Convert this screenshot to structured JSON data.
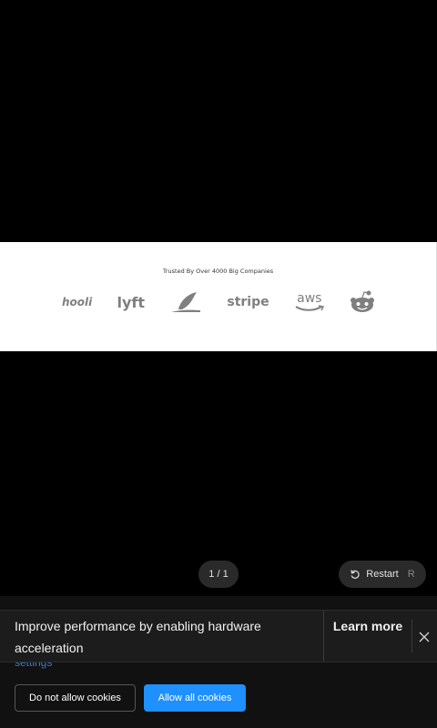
{
  "preview": {
    "trusted_text": "Trusted By Over 4000 Big Companies",
    "logos": [
      {
        "name": "hooli",
        "text": "hooli"
      },
      {
        "name": "lyft",
        "text": "lyft"
      },
      {
        "name": "leaf-brand",
        "text": ""
      },
      {
        "name": "stripe",
        "text": "stripe"
      },
      {
        "name": "aws",
        "text": "aws"
      },
      {
        "name": "reddit",
        "text": ""
      }
    ]
  },
  "controls": {
    "page_indicator": "1 / 1",
    "restart_label": "Restart",
    "restart_shortcut": "R"
  },
  "cookie": {
    "settings_link": "settings",
    "deny_label": "Do not allow cookies",
    "allow_label": "Allow all cookies"
  },
  "toast": {
    "message": "Improve performance by enabling hardware acceleration",
    "learn_more": "Learn more"
  },
  "colors": {
    "accent": "#1e90ff",
    "link": "#3a7bd5",
    "background": "#000000"
  }
}
